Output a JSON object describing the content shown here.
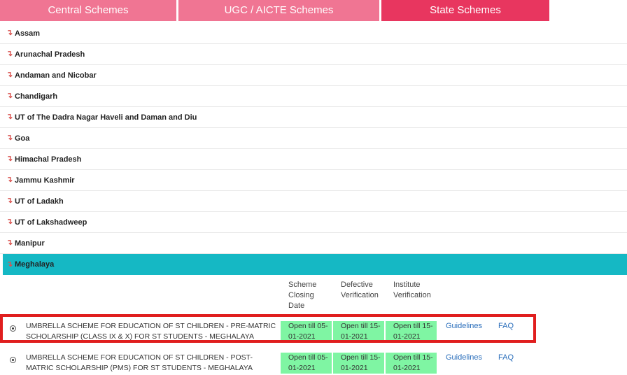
{
  "tabs": [
    {
      "label": "Central Schemes"
    },
    {
      "label": "UGC / AICTE Schemes"
    },
    {
      "label": "State Schemes"
    }
  ],
  "states": [
    {
      "name": "Assam"
    },
    {
      "name": "Arunachal Pradesh"
    },
    {
      "name": "Andaman and Nicobar"
    },
    {
      "name": "Chandigarh"
    },
    {
      "name": "UT of The Dadra Nagar Haveli and Daman and Diu"
    },
    {
      "name": "Goa"
    },
    {
      "name": "Himachal Pradesh"
    },
    {
      "name": "Jammu Kashmir"
    },
    {
      "name": "UT of Ladakh"
    },
    {
      "name": "UT of Lakshadweep"
    },
    {
      "name": "Manipur"
    },
    {
      "name": "Meghalaya"
    }
  ],
  "arrow_glyph": "↴",
  "colors": {
    "active_tab": "#e8365f",
    "tab": "#f07593",
    "active_state": "#15b8c4",
    "open_cell": "#7ff5a3",
    "highlight": "#e01e1e"
  },
  "table": {
    "headers": {
      "closing": "Scheme Closing Date",
      "defective": "Defective Verification",
      "institute": "Institute Verification"
    },
    "schemes": [
      {
        "name": "UMBRELLA SCHEME FOR EDUCATION OF ST CHILDREN - PRE-MATRIC SCHOLARSHIP (CLASS IX & X) FOR ST STUDENTS - MEGHALAYA",
        "closing": "Open till 05-01-2021",
        "defective": "Open till 15-01-2021",
        "institute": "Open till 15-01-2021",
        "guidelines": "Guidelines",
        "faq": "FAQ"
      },
      {
        "name": "UMBRELLA SCHEME FOR EDUCATION OF ST CHILDREN - POST-MATRIC SCHOLARSHIP (PMS) FOR ST STUDENTS - MEGHALAYA",
        "closing": "Open till 05-01-2021",
        "defective": "Open till 15-01-2021",
        "institute": "Open till 15-01-2021",
        "guidelines": "Guidelines",
        "faq": "FAQ"
      }
    ]
  }
}
